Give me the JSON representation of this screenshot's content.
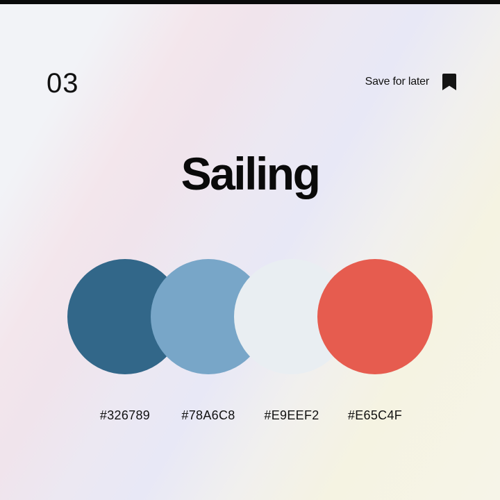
{
  "header": {
    "page_number": "03",
    "save_label": "Save for later",
    "save_icon": "bookmark-icon"
  },
  "title": "Sailing",
  "palette": [
    {
      "color": "#326789",
      "label": "#326789"
    },
    {
      "color": "#78A6C8",
      "label": "#78A6C8"
    },
    {
      "color": "#E9EEF2",
      "label": "#E9EEF2"
    },
    {
      "color": "#E65C4F",
      "label": "#E65C4F"
    }
  ]
}
